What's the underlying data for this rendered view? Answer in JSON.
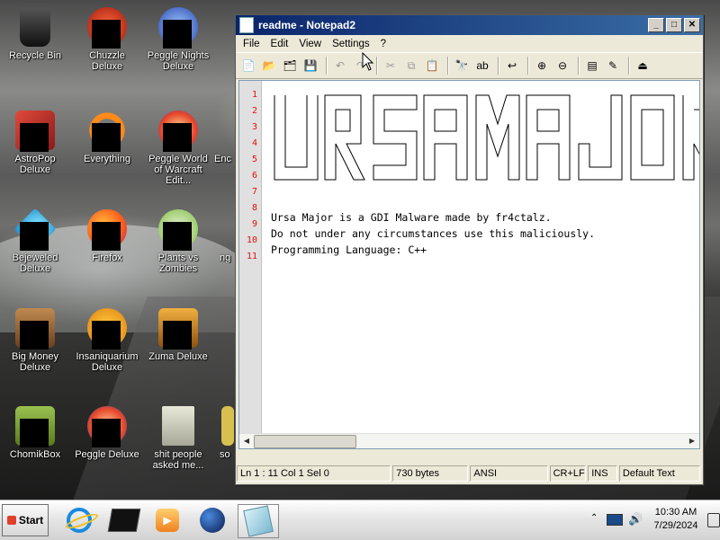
{
  "desktop": {
    "icons": [
      {
        "label": "Recycle Bin",
        "icon": "recycle-bin-icon",
        "color": "#2a2a2a"
      },
      {
        "label": "Chuzzle Deluxe",
        "icon": "chuzzle-icon",
        "color": "#c83a20"
      },
      {
        "label": "Peggle Nights Deluxe",
        "icon": "peggle-nights-icon",
        "color": "#3b6fd0"
      },
      {
        "label": "AstroPop Deluxe",
        "icon": "astropop-icon",
        "color": "#c8282a"
      },
      {
        "label": "Everything",
        "icon": "everything-icon",
        "color": "#ff8a1a"
      },
      {
        "label": "Peggle World of Warcraft Edit...",
        "icon": "peggle-wow-icon",
        "color": "#e84a2a"
      },
      {
        "label": "Enc",
        "icon": "app-icon",
        "color": "#888888"
      },
      {
        "label": "Bejeweled Deluxe",
        "icon": "bejeweled-icon",
        "color": "#20b8e8"
      },
      {
        "label": "Firefox",
        "icon": "firefox-icon",
        "color": "#ff7a1a"
      },
      {
        "label": "Plants vs Zombies",
        "icon": "pvz-icon",
        "color": "#7ac040"
      },
      {
        "label": "ng",
        "icon": "app-icon",
        "color": "#888888"
      },
      {
        "label": "Big Money Deluxe",
        "icon": "big-money-icon",
        "color": "#a06a3a"
      },
      {
        "label": "Insaniquarium Deluxe",
        "icon": "insaniquarium-icon",
        "color": "#f0a020"
      },
      {
        "label": "Zuma Deluxe",
        "icon": "zuma-icon",
        "color": "#d08a2a"
      },
      {
        "label": "ChomikBox",
        "icon": "chomikbox-icon",
        "color": "#7aa040"
      },
      {
        "label": "Peggle Deluxe",
        "icon": "peggle-deluxe-icon",
        "color": "#e84a2a"
      },
      {
        "label": "shit people asked me...",
        "icon": "folder-icon",
        "color": "#c0c0b0"
      },
      {
        "label": "so",
        "icon": "app-icon",
        "color": "#d8c050"
      }
    ]
  },
  "window": {
    "title": "readme - Notepad2",
    "menu": [
      "File",
      "Edit",
      "View",
      "Settings",
      "?"
    ],
    "toolbar_icons": [
      "new-icon",
      "open-icon",
      "browse-icon",
      "save-icon",
      "undo-icon",
      "redo-icon",
      "cut-icon",
      "copy-icon",
      "paste-icon",
      "find-icon",
      "replace-icon",
      "wordwrap-icon",
      "zoom-in-icon",
      "zoom-out-icon",
      "scheme-icon",
      "customize-icon",
      "exit-icon"
    ],
    "line_numbers": [
      "1",
      "2",
      "3",
      "4",
      "5",
      "6",
      "7",
      "8",
      "9",
      "10",
      "11"
    ],
    "text_lines": [
      "Ursa Major is a GDI Malware made by fr4ctalz.",
      "Do not under any circumstances use this maliciously.",
      "Programming Language: C++"
    ],
    "status": {
      "position": "Ln 1 : 11   Col 1   Sel 0",
      "size": "730 bytes",
      "encoding": "ANSI",
      "eol": "CR+LF",
      "mode": "INS",
      "scheme": "Default Text"
    }
  },
  "taskbar": {
    "start_label": "Start",
    "time": "10:30 AM",
    "date": "7/29/2024"
  }
}
